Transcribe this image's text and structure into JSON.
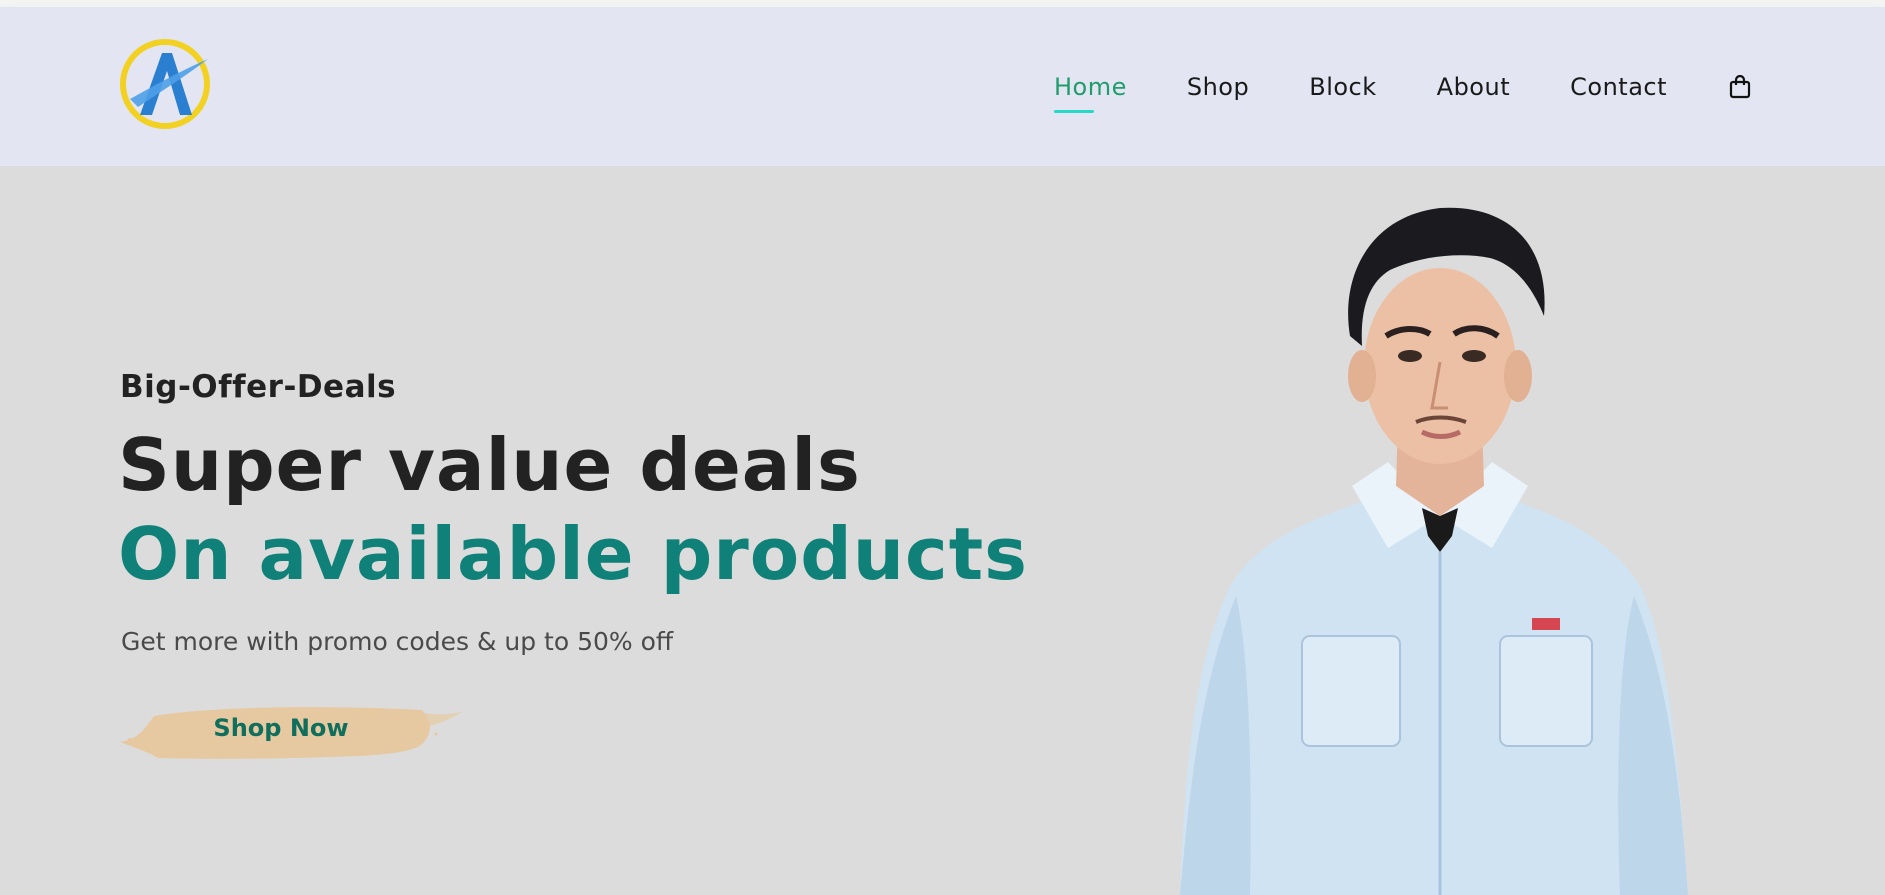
{
  "nav": {
    "items": [
      {
        "label": "Home",
        "active": true
      },
      {
        "label": "Shop",
        "active": false
      },
      {
        "label": "Block",
        "active": false
      },
      {
        "label": "About",
        "active": false
      },
      {
        "label": "Contact",
        "active": false
      }
    ],
    "cart_icon": "shopping-bag-icon"
  },
  "logo": {
    "icon": "logo-a-mark",
    "colors": {
      "ring": "#f2d122",
      "letter": "#2b7fd0"
    }
  },
  "hero": {
    "eyebrow": "Big-Offer-Deals",
    "title_line1": "Super value deals",
    "title_line2": "On available products",
    "promo": "Get more with promo codes & up to 50% off",
    "cta_label": "Shop Now"
  },
  "colors": {
    "accent_green": "#0f8178",
    "nav_active": "#1f9d6b",
    "nav_underline": "#26d9c7",
    "header_bg": "#e3e6f2",
    "hero_bg": "#dcdcdc",
    "cta_brush": "#e6c9a0"
  }
}
